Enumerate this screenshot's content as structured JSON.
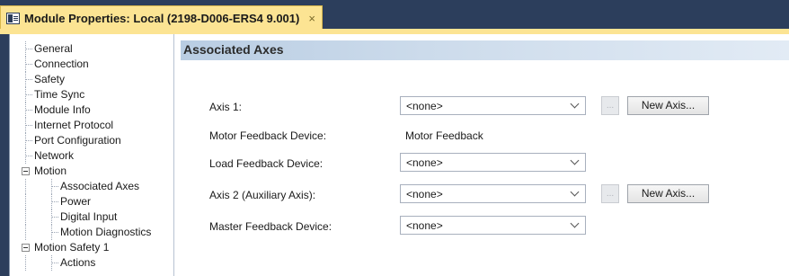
{
  "tab": {
    "title": "Module Properties: Local (2198-D006-ERS4 9.001)",
    "close_glyph": "×",
    "icon": "module-properties-icon"
  },
  "tree": {
    "items": [
      {
        "label": "General"
      },
      {
        "label": "Connection"
      },
      {
        "label": "Safety"
      },
      {
        "label": "Time Sync"
      },
      {
        "label": "Module Info"
      },
      {
        "label": "Internet Protocol"
      },
      {
        "label": "Port Configuration"
      },
      {
        "label": "Network"
      },
      {
        "label": "Motion"
      },
      {
        "label": "Associated Axes"
      },
      {
        "label": "Power"
      },
      {
        "label": "Digital Input"
      },
      {
        "label": "Motion Diagnostics"
      },
      {
        "label": "Motion Safety 1"
      },
      {
        "label": "Actions"
      }
    ],
    "selected": "Associated Axes"
  },
  "section": {
    "title": "Associated Axes"
  },
  "form": {
    "axis1": {
      "label": "Axis 1:",
      "value": "<none>",
      "ellipsis": "...",
      "new_button": "New Axis..."
    },
    "motor_feedback": {
      "label": "Motor Feedback Device:",
      "value": "Motor Feedback"
    },
    "load_feedback": {
      "label": "Load Feedback Device:",
      "value": "<none>"
    },
    "axis2": {
      "label": "Axis 2  (Auxiliary Axis):",
      "value": "<none>",
      "ellipsis": "...",
      "new_button": "New Axis..."
    },
    "master_feedback": {
      "label": "Master Feedback Device:",
      "value": "<none>"
    }
  },
  "colors": {
    "tab_background": "#fce493",
    "ide_background": "#2c3e5c",
    "section_header": "#b9cde3"
  }
}
